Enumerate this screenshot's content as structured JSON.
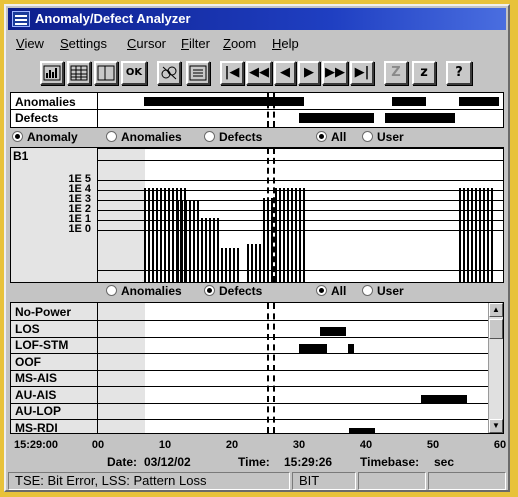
{
  "app": {
    "title": "Anomaly/Defect Analyzer"
  },
  "menu": [
    "View",
    "Settings",
    "Cursor",
    "Filter",
    "Zoom",
    "Help"
  ],
  "toolbar": {
    "ok_label": "OK",
    "nav_first": "|◀",
    "nav_prev_fast": "◀◀",
    "nav_prev": "◀",
    "nav_next": "▶",
    "nav_next_fast": "▶▶",
    "nav_last": "▶|",
    "zoom_icon": "Z",
    "zoom_z": "z",
    "help": "?",
    "icons": [
      "chart-icon",
      "grid-icon",
      "window-icon",
      "check-ok-icon",
      "analyzer-icon",
      "list-icon"
    ]
  },
  "summary": {
    "rows": [
      "Anomalies",
      "Defects"
    ]
  },
  "filter1": {
    "anomaly": "Anomaly",
    "anomalies": "Anomalies",
    "defects": "Defects",
    "all": "All",
    "user": "User",
    "selected": "anomaly",
    "scope": "all"
  },
  "histogram": {
    "title": "B1",
    "y_ticks": [
      "1E 5",
      "1E 4",
      "1E 3",
      "1E 2",
      "1E 1",
      "1E 0"
    ]
  },
  "filter2": {
    "anomalies": "Anomalies",
    "defects": "Defects",
    "all": "All",
    "user": "User",
    "selected": "defects",
    "scope": "all"
  },
  "defects": {
    "rows": [
      "No-Power",
      "LOS",
      "LOF-STM",
      "OOF",
      "MS-AIS",
      "AU-AIS",
      "AU-LOP",
      "MS-RDI"
    ]
  },
  "timeaxis": {
    "start": "15:29:00",
    "ticks": [
      "00",
      "10",
      "20",
      "30",
      "40",
      "50",
      "60"
    ]
  },
  "info": {
    "date_label": "Date:",
    "date": "03/12/02",
    "time_label": "Time:",
    "time": "15:29:26",
    "timebase_label": "Timebase:",
    "timebase": "sec"
  },
  "statusbar": {
    "text": "TSE: Bit Error, LSS: Pattern Loss",
    "mode": "BIT"
  }
}
